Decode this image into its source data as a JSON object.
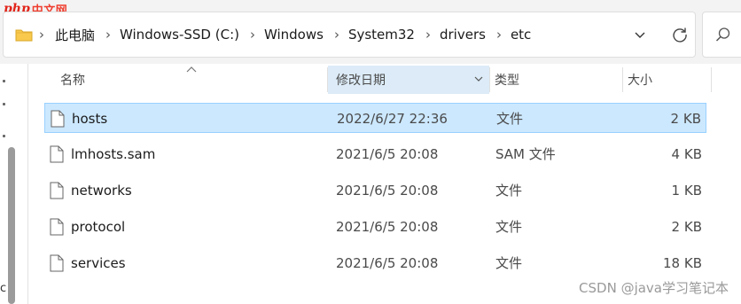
{
  "logo": {
    "php": "php",
    "cn": "中文网"
  },
  "address": {
    "crumbs": [
      "此电脑",
      "Windows-SSD (C:)",
      "Windows",
      "System32",
      "drivers",
      "etc"
    ]
  },
  "columns": {
    "name": "名称",
    "date": "修改日期",
    "type": "类型",
    "size": "大小"
  },
  "files": [
    {
      "name": "hosts",
      "date": "2022/6/27 22:36",
      "type": "文件",
      "size": "2 KB",
      "selected": true
    },
    {
      "name": "lmhosts.sam",
      "date": "2021/6/5 20:08",
      "type": "SAM 文件",
      "size": "4 KB"
    },
    {
      "name": "networks",
      "date": "2021/6/5 20:08",
      "type": "文件",
      "size": "1 KB"
    },
    {
      "name": "protocol",
      "date": "2021/6/5 20:08",
      "type": "文件",
      "size": "2 KB"
    },
    {
      "name": "services",
      "date": "2021/6/5 20:08",
      "type": "文件",
      "size": "18 KB"
    }
  ],
  "watermark": "CSDN @java学习笔记本",
  "left_glyph": "c",
  "icons": {
    "folder": "folder-icon",
    "dropdown": "chevron-down-icon",
    "refresh": "refresh-icon",
    "search": "search-icon",
    "file": "file-icon",
    "sort": "sort-up-icon"
  },
  "colors": {
    "selection": "#cce8ff",
    "selection_border": "#99d1ff",
    "sorted_header": "#dcebf7"
  }
}
